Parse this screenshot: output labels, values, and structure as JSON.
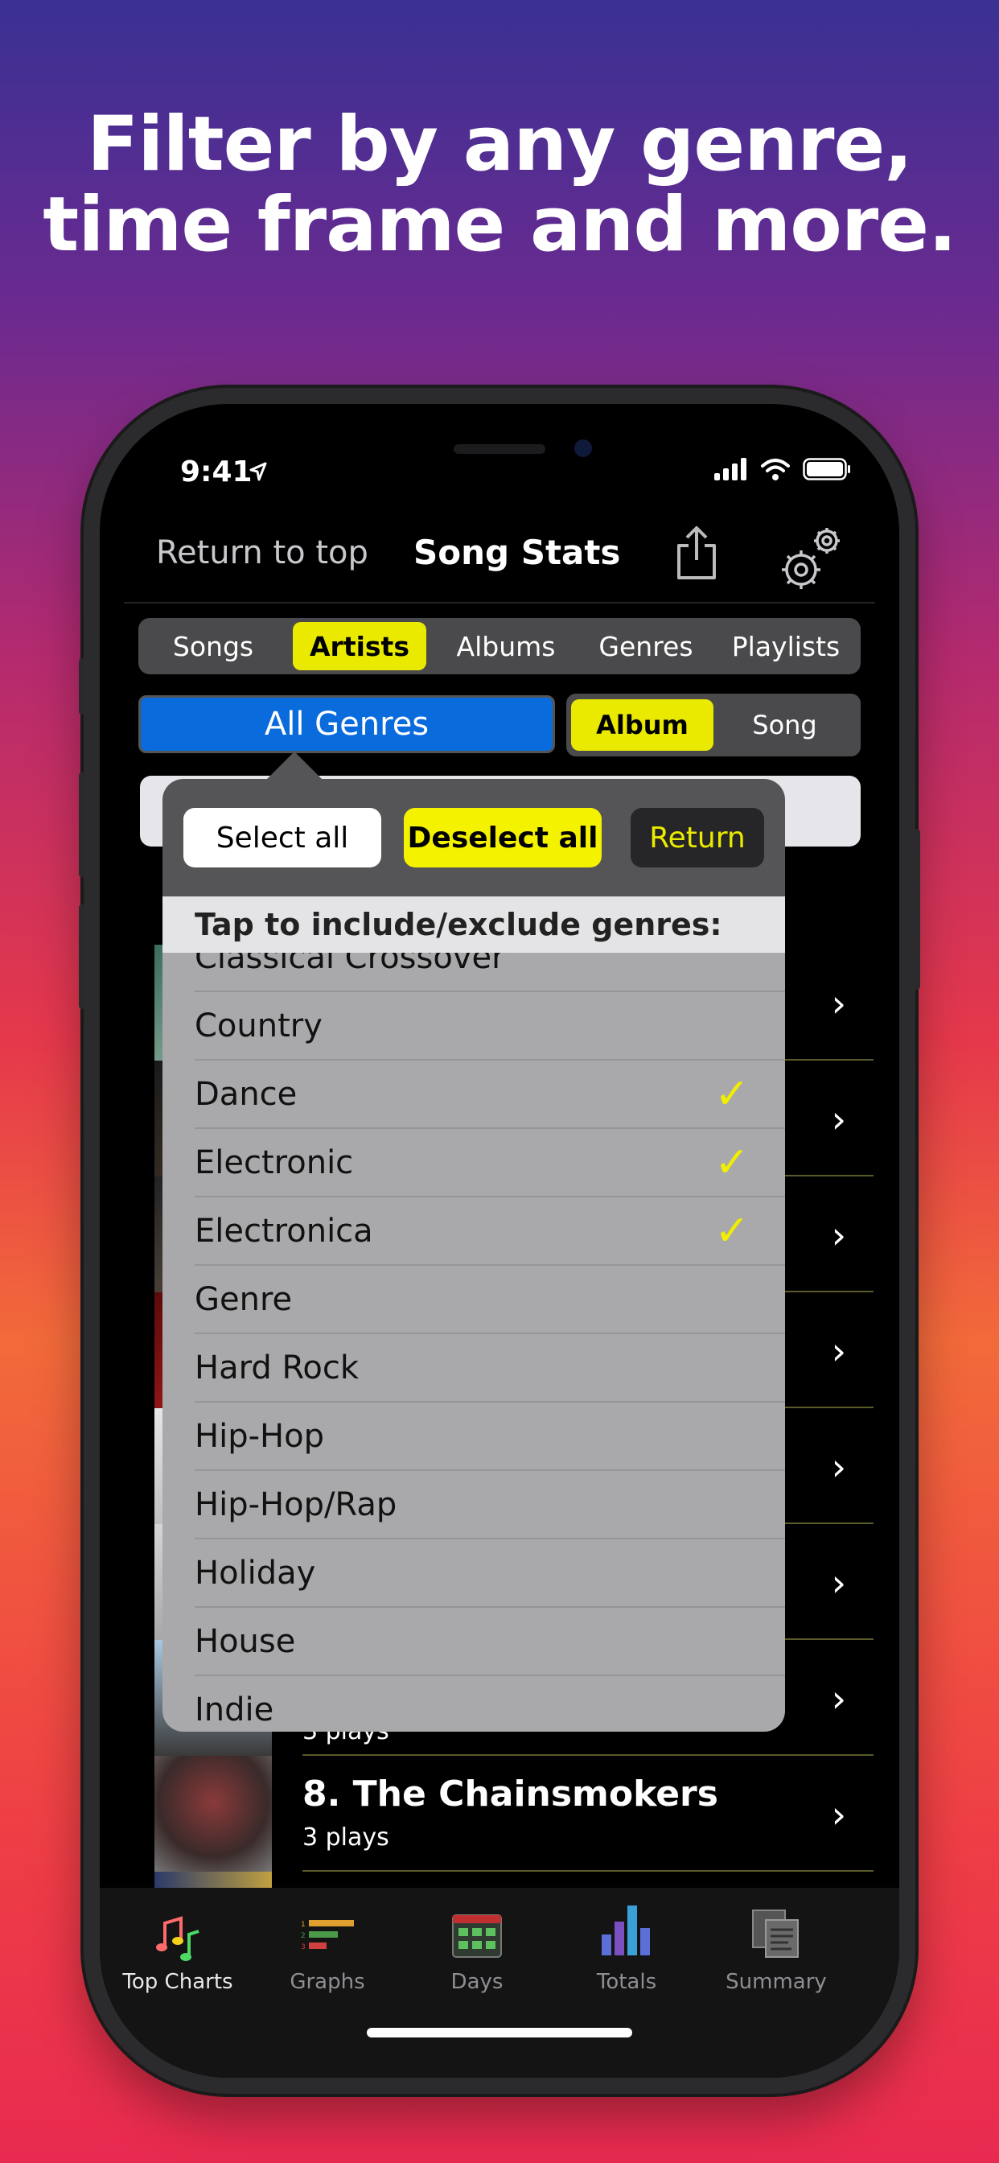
{
  "headline": {
    "line1": "Filter by any genre,",
    "line2": "time frame and more."
  },
  "status": {
    "time": "9:41"
  },
  "nav": {
    "return_label": "Return to top",
    "title": "Song Stats"
  },
  "tabs_top": [
    "Songs",
    "Artists",
    "Albums",
    "Genres",
    "Playlists"
  ],
  "active_top_tab": "Artists",
  "genre_button": "All Genres",
  "album_song": {
    "album": "Album",
    "song": "Song",
    "active": "Album"
  },
  "popover": {
    "select_all": "Select all",
    "deselect_all": "Deselect all",
    "return": "Return",
    "header": "Tap to include/exclude genres:",
    "genres": [
      {
        "name": "Classical Crossover",
        "checked": false
      },
      {
        "name": "Country",
        "checked": false
      },
      {
        "name": "Dance",
        "checked": true
      },
      {
        "name": "Electronic",
        "checked": true
      },
      {
        "name": "Electronica",
        "checked": true
      },
      {
        "name": "Genre",
        "checked": false
      },
      {
        "name": "Hard Rock",
        "checked": false
      },
      {
        "name": "Hip-Hop",
        "checked": false
      },
      {
        "name": "Hip-Hop/Rap",
        "checked": false
      },
      {
        "name": "Holiday",
        "checked": false
      },
      {
        "name": "House",
        "checked": false
      },
      {
        "name": "Indie",
        "checked": false
      }
    ],
    "check_glyph": "✓"
  },
  "list": {
    "visible_row": {
      "title": "8. The Chainsmokers",
      "sub": "3 plays"
    },
    "partial_sub": "3 plays"
  },
  "tabbar": [
    {
      "label": "Top Charts",
      "icon": "music-notes-icon"
    },
    {
      "label": "Graphs",
      "icon": "bar-graph-icon"
    },
    {
      "label": "Days",
      "icon": "calendar-icon"
    },
    {
      "label": "Totals",
      "icon": "totals-bars-icon"
    },
    {
      "label": "Summary",
      "icon": "summary-docs-icon"
    }
  ],
  "colors": {
    "accent_yellow": "#eaea00",
    "genre_blue": "#0a6bdc"
  }
}
